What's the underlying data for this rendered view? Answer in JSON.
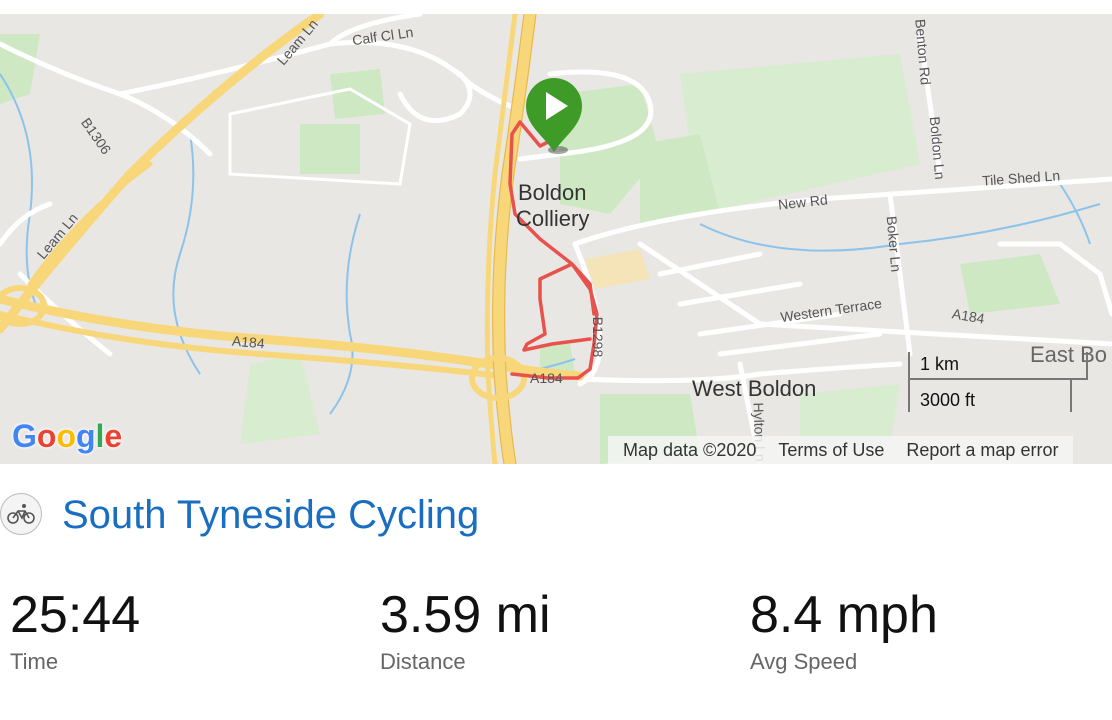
{
  "map": {
    "road_labels": [
      "Calf Cl Ln",
      "Leam Ln",
      "B1306",
      "Leam Ln",
      "A184",
      "A184",
      "B1298",
      "New Rd",
      "Boker Ln",
      "Benton Rd",
      "Boldon Ln",
      "Tile Shed Ln",
      "Western Terrace",
      "A184",
      "Hylton Ln"
    ],
    "place_labels": {
      "colliery_line1": "Boldon",
      "colliery_line2": "Colliery",
      "west_boldon": "West Boldon",
      "east_boldon": "East Bo"
    },
    "scale": {
      "metric": "1 km",
      "imperial": "3000 ft"
    },
    "logo": "Google",
    "attribution": {
      "map_data": "Map data ©2020",
      "terms": "Terms of Use",
      "report": "Report a map error"
    },
    "colors": {
      "route": "#e8524d",
      "start_marker": "#3f9b27",
      "motorway": "#f8d77a"
    }
  },
  "activity": {
    "icon": "bicycle-icon",
    "title": "South Tyneside Cycling"
  },
  "stats": [
    {
      "value": "25:44",
      "label": "Time"
    },
    {
      "value": "3.59 mi",
      "label": "Distance"
    },
    {
      "value": "8.4 mph",
      "label": "Avg Speed"
    }
  ]
}
